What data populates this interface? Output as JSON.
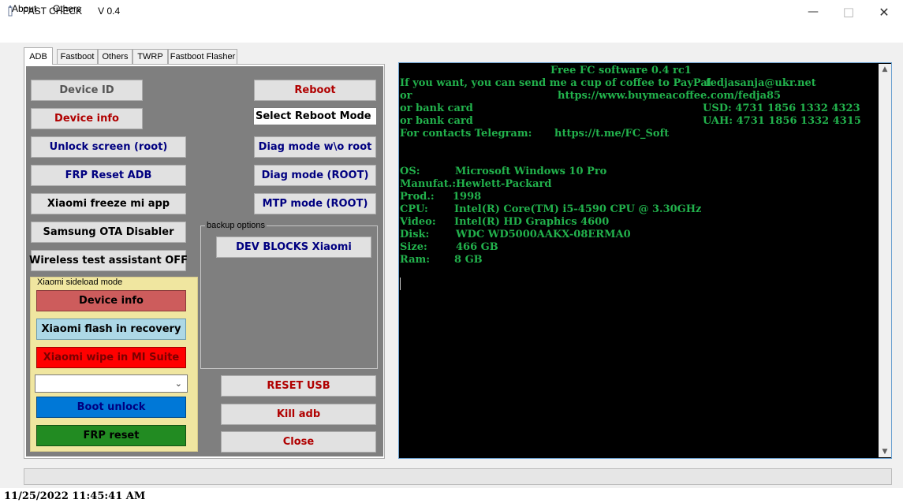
{
  "window": {
    "title": "FAST CHECK      V 0.4"
  },
  "menu": {
    "about": "About",
    "others": "Others"
  },
  "tabs": [
    "ADB",
    "Fastboot",
    "Others",
    "TWRP",
    "Fastboot Flasher"
  ],
  "adb": {
    "device_id": "Device ID",
    "device_info": "Device info",
    "unlock_screen": "Unlock screen (root)",
    "frp_reset_adb": "FRP Reset ADB",
    "xiaomi_freeze": "Xiaomi freeze mi app",
    "samsung_ota": "Samsung OTA Disabler",
    "wireless_test": "Wireless test assistant OFF",
    "reboot": "Reboot",
    "reboot_mode_selected": "Select Reboot Mode",
    "diag_noroot": "Diag mode w\\o root",
    "diag_root": "Diag mode (ROOT)",
    "mtp_root": "MTP mode (ROOT)",
    "backup_group_label": "backup options",
    "dev_blocks": "DEV BLOCKS Xiaomi",
    "reset_usb": "RESET USB",
    "kill_adb": "Kill adb",
    "close": "Close"
  },
  "xiaomi_sideload": {
    "group_label": "Xiaomi sideload mode",
    "device_info": "Device info",
    "flash_recovery": "Xiaomi flash in recovery",
    "wipe_mi_suite": "Xiaomi wipe in MI Suite",
    "combo_value": "",
    "boot_unlock": "Boot unlock",
    "frp_reset": "FRP reset"
  },
  "console": {
    "lines": [
      "Free FC software 0.4 rc1",
      "If you want, you can send me a cup of coffee to PayPal",
      "fedjasanja@ukr.net",
      "or",
      "https://www.buymeacoffee.com/fedja85",
      "or bank card",
      "USD: 4731 1856 1332 4323",
      "or bank card",
      "UAH: 4731 1856 1332 4315",
      "For contacts Telegram:",
      "https://t.me/FC_Soft"
    ],
    "info": [
      {
        "label": "OS:",
        "value": "Microsoft Windows 10 Pro"
      },
      {
        "label": "Manufat.:",
        "value": "Hewlett-Packard"
      },
      {
        "label": "Prod.:",
        "value": "1998"
      },
      {
        "label": "CPU:",
        "value": "Intel(R) Core(TM) i5-4590 CPU @ 3.30GHz"
      },
      {
        "label": "Video:",
        "value": "Intel(R) HD Graphics 4600"
      },
      {
        "label": "Disk:",
        "value": "WDC WD5000AAKX-08ERMA0"
      },
      {
        "label": "Size:",
        "value": "466 GB"
      },
      {
        "label": "Ram:",
        "value": "8 GB"
      }
    ]
  },
  "progress": {
    "value": 0
  },
  "status": {
    "datetime": "11/25/2022 11:45:41 AM"
  },
  "colors": {
    "console_text": "#22b14c",
    "device_info_red": "#cd5c5c",
    "flash_light_blue": "#add8e6",
    "wipe_red": "#ff0000",
    "boot_unlock_blue": "#0078d7",
    "frp_green": "#228b22"
  },
  "icons": {
    "app": "app-icon",
    "minimize": "minimize-icon",
    "maximize": "maximize-icon",
    "close": "close-icon",
    "dropdown": "chevron-down-icon",
    "scroll_up": "scroll-up-icon",
    "scroll_down": "scroll-down-icon"
  }
}
